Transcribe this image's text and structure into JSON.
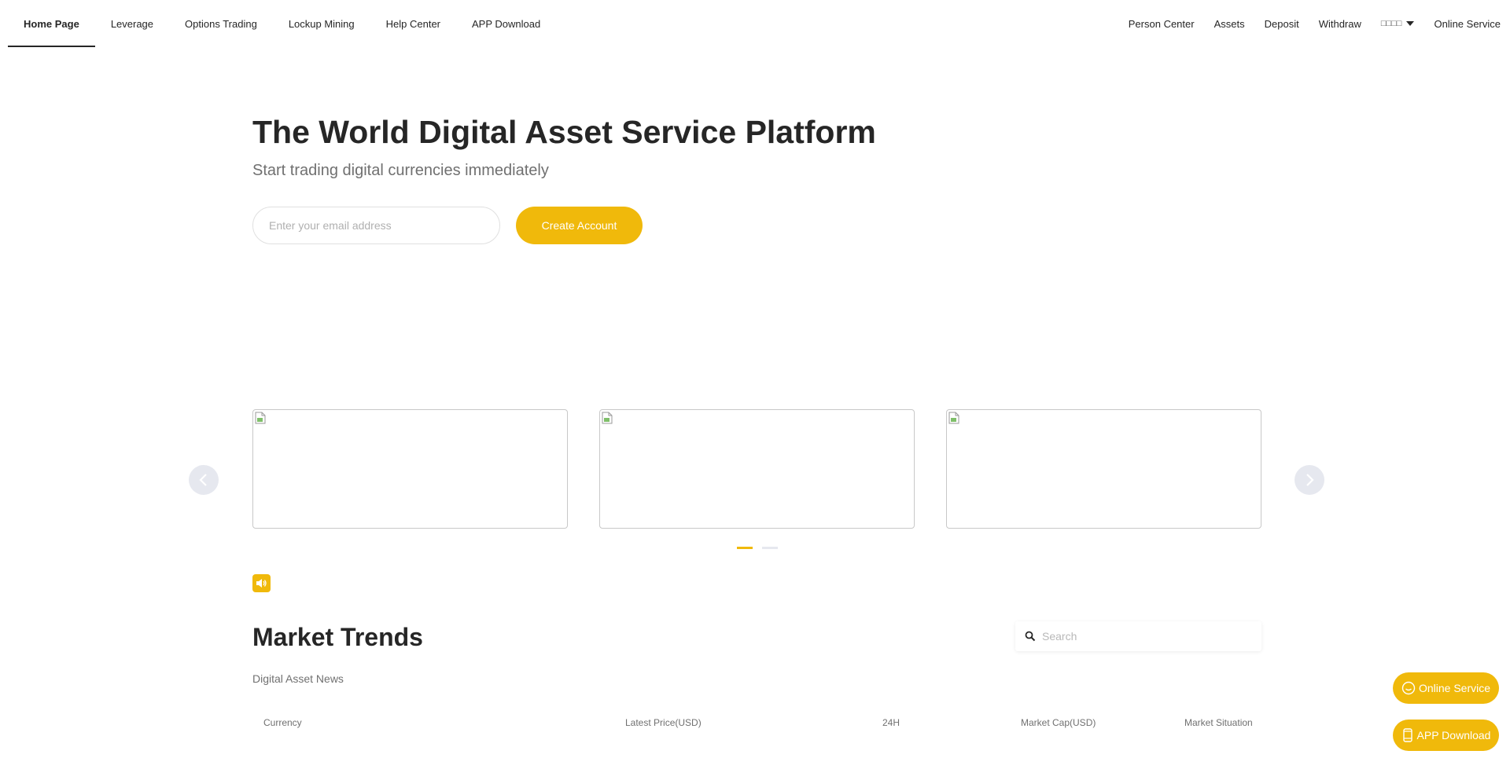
{
  "nav": {
    "left_items": [
      {
        "label": "Home Page"
      },
      {
        "label": "Leverage"
      },
      {
        "label": "Options Trading"
      },
      {
        "label": "Lockup Mining"
      },
      {
        "label": "Help Center"
      },
      {
        "label": "APP Download"
      }
    ],
    "active_item": "Home Page",
    "right_items": {
      "person_center": "Person Center",
      "assets": "Assets",
      "deposit": "Deposit",
      "withdraw": "Withdraw",
      "language": "□□□□",
      "online_service": "Online Service"
    }
  },
  "hero": {
    "title": "The World Digital Asset Service Platform",
    "subtitle": "Start trading digital currencies immediately",
    "email_placeholder": "Enter your email address",
    "email_value": "",
    "cta_label": "Create Account"
  },
  "carousel": {
    "banner_count": 3,
    "page_count": 2,
    "active_page": 1
  },
  "notice": {
    "icon": "speaker-icon"
  },
  "market": {
    "title": "Market Trends",
    "subtitle": "Digital Asset News",
    "search_placeholder": "Search",
    "search_value": "",
    "columns": {
      "currency": "Currency",
      "price": "Latest Price(USD)",
      "change_24h": "24H",
      "market_cap": "Market Cap(USD)",
      "situation": "Market Situation"
    }
  },
  "floating": {
    "service_label": "Online Service",
    "app_label": "APP Download"
  },
  "colors": {
    "accent": "#f0b90b",
    "text_primary": "#262626",
    "text_secondary": "#707070",
    "arrow_bg": "#e6e8ef"
  }
}
